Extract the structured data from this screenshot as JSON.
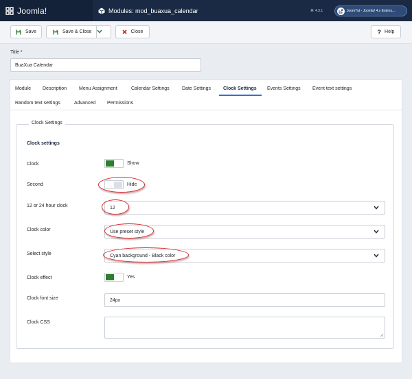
{
  "app": {
    "brand": "Joomla!",
    "page_title": "Modules: mod_buaxua_calendar",
    "version": "4.3.1",
    "site_label": "JoomTut - Joomla! 4.x Extens..."
  },
  "toolbar": {
    "save": "Save",
    "save_close": "Save & Close",
    "close": "Close",
    "help": "Help"
  },
  "title_field": {
    "label": "Title *",
    "value": "BuaXua Calendar"
  },
  "tabs": [
    {
      "label": "Module",
      "active": false
    },
    {
      "label": "Description",
      "active": false
    },
    {
      "label": "Menu Assignment",
      "active": false
    },
    {
      "label": "Calendar Settings",
      "active": false
    },
    {
      "label": "Date Settings",
      "active": false
    },
    {
      "label": "Clock Settings",
      "active": true
    },
    {
      "label": "Events Settings",
      "active": false
    },
    {
      "label": "Event text settings",
      "active": false
    },
    {
      "label": "Random text settings",
      "active": false
    },
    {
      "label": "Advanced",
      "active": false
    },
    {
      "label": "Permissions",
      "active": false
    }
  ],
  "clock_settings": {
    "legend": "Clock Settings",
    "heading": "Clock settings",
    "clock": {
      "label": "Clock",
      "state": "Show",
      "on": true
    },
    "second": {
      "label": "Second",
      "state": "Hide",
      "on": false
    },
    "hour_format": {
      "label": "12 or 24 hour clock",
      "value": "12"
    },
    "clock_color": {
      "label": "Clock color",
      "value": "Use preset style"
    },
    "select_style": {
      "label": "Select style",
      "value": "Cyan background - Black color"
    },
    "clock_effect": {
      "label": "Clock effect",
      "state": "Yes",
      "on": true
    },
    "font_size": {
      "label": "Clock font size",
      "value": "24px"
    },
    "clock_css": {
      "label": "Clock CSS",
      "value": ""
    }
  },
  "colors": {
    "header_bg": "#1a2a44",
    "toggle_on": "#2e7d32",
    "save_icon": "#2e7d32",
    "close_icon": "#c62828",
    "annotation": "#d4292f",
    "active_tab_underline": "#3b6ad1"
  }
}
